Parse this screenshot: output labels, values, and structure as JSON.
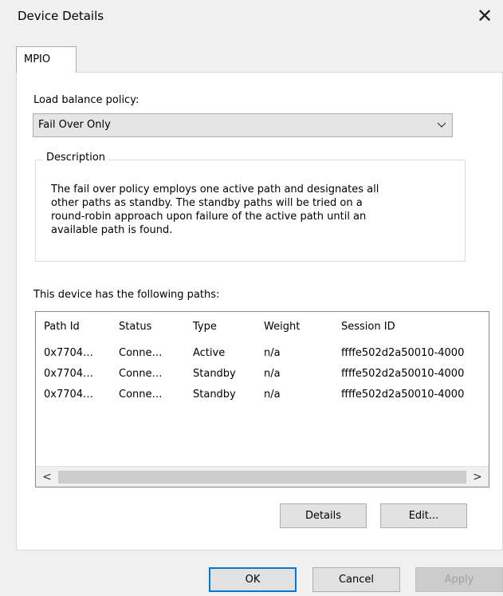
{
  "window": {
    "title": "Device Details",
    "close_glyph": "✕"
  },
  "tabs": [
    {
      "label": "MPIO"
    }
  ],
  "load_balance": {
    "label": "Load balance policy:",
    "selected": "Fail Over Only"
  },
  "description": {
    "title": "Description",
    "lines": [
      "The fail over policy employs one active path and designates all",
      "other paths as standby.  The standby paths will be tried on a",
      "round-robin approach upon failure of the active path until an",
      "available path is found."
    ]
  },
  "paths": {
    "label": "This device has the following paths:",
    "columns": [
      "Path Id",
      "Status",
      "Type",
      "Weight",
      "Session ID"
    ],
    "rows": [
      [
        "0x7704…",
        "Conne…",
        "Active",
        "n/a",
        "ffffe502d2a50010-4000"
      ],
      [
        "0x7704…",
        "Conne…",
        "Standby",
        "n/a",
        "ffffe502d2a50010-4000"
      ],
      [
        "0x7704…",
        "Conne…",
        "Standby",
        "n/a",
        "ffffe502d2a50010-4000"
      ]
    ],
    "scroll_left": "<",
    "scroll_right": ">"
  },
  "panel_buttons": {
    "details": "Details",
    "edit": "Edit..."
  },
  "dialog_buttons": {
    "ok": "OK",
    "cancel": "Cancel",
    "apply": "Apply"
  },
  "colors": {
    "accent": "#0078d7",
    "button_face": "#e1e1e1",
    "window_bg": "#f0f0f0"
  },
  "icons": {
    "close": "close-icon",
    "dropdown": "chevron-down-icon"
  }
}
